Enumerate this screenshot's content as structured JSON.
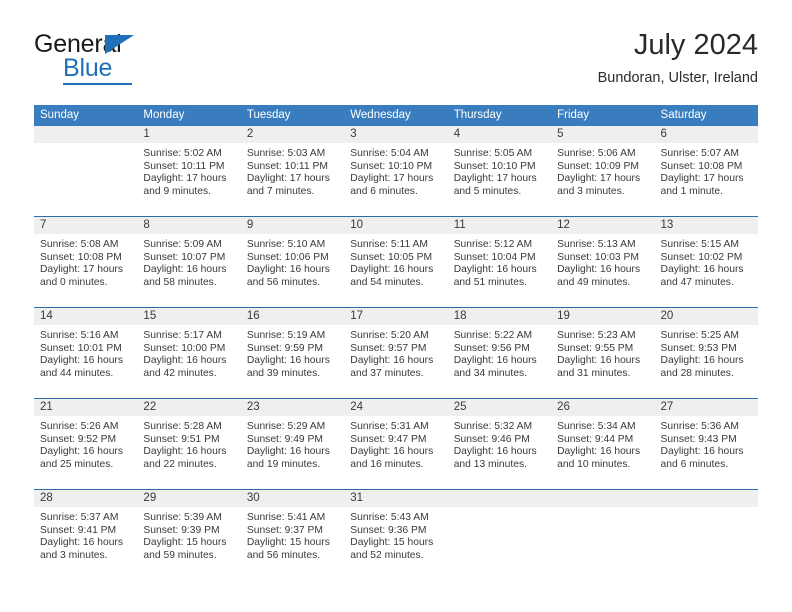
{
  "logo": {
    "word1": "General",
    "word2": "Blue",
    "triangle_icon": "triangle-icon",
    "brand_color": "#1f70b8"
  },
  "header": {
    "title": "July 2024",
    "subtitle": "Bundoran, Ulster, Ireland"
  },
  "calendar": {
    "header_bg": "#3a7dbf",
    "weekday_headers": [
      "Sunday",
      "Monday",
      "Tuesday",
      "Wednesday",
      "Thursday",
      "Friday",
      "Saturday"
    ],
    "weeks": [
      [
        {
          "day": "",
          "lines": []
        },
        {
          "day": "1",
          "lines": [
            "Sunrise: 5:02 AM",
            "Sunset: 10:11 PM",
            "Daylight: 17 hours",
            "and 9 minutes."
          ]
        },
        {
          "day": "2",
          "lines": [
            "Sunrise: 5:03 AM",
            "Sunset: 10:11 PM",
            "Daylight: 17 hours",
            "and 7 minutes."
          ]
        },
        {
          "day": "3",
          "lines": [
            "Sunrise: 5:04 AM",
            "Sunset: 10:10 PM",
            "Daylight: 17 hours",
            "and 6 minutes."
          ]
        },
        {
          "day": "4",
          "lines": [
            "Sunrise: 5:05 AM",
            "Sunset: 10:10 PM",
            "Daylight: 17 hours",
            "and 5 minutes."
          ]
        },
        {
          "day": "5",
          "lines": [
            "Sunrise: 5:06 AM",
            "Sunset: 10:09 PM",
            "Daylight: 17 hours",
            "and 3 minutes."
          ]
        },
        {
          "day": "6",
          "lines": [
            "Sunrise: 5:07 AM",
            "Sunset: 10:08 PM",
            "Daylight: 17 hours",
            "and 1 minute."
          ]
        }
      ],
      [
        {
          "day": "7",
          "lines": [
            "Sunrise: 5:08 AM",
            "Sunset: 10:08 PM",
            "Daylight: 17 hours",
            "and 0 minutes."
          ]
        },
        {
          "day": "8",
          "lines": [
            "Sunrise: 5:09 AM",
            "Sunset: 10:07 PM",
            "Daylight: 16 hours",
            "and 58 minutes."
          ]
        },
        {
          "day": "9",
          "lines": [
            "Sunrise: 5:10 AM",
            "Sunset: 10:06 PM",
            "Daylight: 16 hours",
            "and 56 minutes."
          ]
        },
        {
          "day": "10",
          "lines": [
            "Sunrise: 5:11 AM",
            "Sunset: 10:05 PM",
            "Daylight: 16 hours",
            "and 54 minutes."
          ]
        },
        {
          "day": "11",
          "lines": [
            "Sunrise: 5:12 AM",
            "Sunset: 10:04 PM",
            "Daylight: 16 hours",
            "and 51 minutes."
          ]
        },
        {
          "day": "12",
          "lines": [
            "Sunrise: 5:13 AM",
            "Sunset: 10:03 PM",
            "Daylight: 16 hours",
            "and 49 minutes."
          ]
        },
        {
          "day": "13",
          "lines": [
            "Sunrise: 5:15 AM",
            "Sunset: 10:02 PM",
            "Daylight: 16 hours",
            "and 47 minutes."
          ]
        }
      ],
      [
        {
          "day": "14",
          "lines": [
            "Sunrise: 5:16 AM",
            "Sunset: 10:01 PM",
            "Daylight: 16 hours",
            "and 44 minutes."
          ]
        },
        {
          "day": "15",
          "lines": [
            "Sunrise: 5:17 AM",
            "Sunset: 10:00 PM",
            "Daylight: 16 hours",
            "and 42 minutes."
          ]
        },
        {
          "day": "16",
          "lines": [
            "Sunrise: 5:19 AM",
            "Sunset: 9:59 PM",
            "Daylight: 16 hours",
            "and 39 minutes."
          ]
        },
        {
          "day": "17",
          "lines": [
            "Sunrise: 5:20 AM",
            "Sunset: 9:57 PM",
            "Daylight: 16 hours",
            "and 37 minutes."
          ]
        },
        {
          "day": "18",
          "lines": [
            "Sunrise: 5:22 AM",
            "Sunset: 9:56 PM",
            "Daylight: 16 hours",
            "and 34 minutes."
          ]
        },
        {
          "day": "19",
          "lines": [
            "Sunrise: 5:23 AM",
            "Sunset: 9:55 PM",
            "Daylight: 16 hours",
            "and 31 minutes."
          ]
        },
        {
          "day": "20",
          "lines": [
            "Sunrise: 5:25 AM",
            "Sunset: 9:53 PM",
            "Daylight: 16 hours",
            "and 28 minutes."
          ]
        }
      ],
      [
        {
          "day": "21",
          "lines": [
            "Sunrise: 5:26 AM",
            "Sunset: 9:52 PM",
            "Daylight: 16 hours",
            "and 25 minutes."
          ]
        },
        {
          "day": "22",
          "lines": [
            "Sunrise: 5:28 AM",
            "Sunset: 9:51 PM",
            "Daylight: 16 hours",
            "and 22 minutes."
          ]
        },
        {
          "day": "23",
          "lines": [
            "Sunrise: 5:29 AM",
            "Sunset: 9:49 PM",
            "Daylight: 16 hours",
            "and 19 minutes."
          ]
        },
        {
          "day": "24",
          "lines": [
            "Sunrise: 5:31 AM",
            "Sunset: 9:47 PM",
            "Daylight: 16 hours",
            "and 16 minutes."
          ]
        },
        {
          "day": "25",
          "lines": [
            "Sunrise: 5:32 AM",
            "Sunset: 9:46 PM",
            "Daylight: 16 hours",
            "and 13 minutes."
          ]
        },
        {
          "day": "26",
          "lines": [
            "Sunrise: 5:34 AM",
            "Sunset: 9:44 PM",
            "Daylight: 16 hours",
            "and 10 minutes."
          ]
        },
        {
          "day": "27",
          "lines": [
            "Sunrise: 5:36 AM",
            "Sunset: 9:43 PM",
            "Daylight: 16 hours",
            "and 6 minutes."
          ]
        }
      ],
      [
        {
          "day": "28",
          "lines": [
            "Sunrise: 5:37 AM",
            "Sunset: 9:41 PM",
            "Daylight: 16 hours",
            "and 3 minutes."
          ]
        },
        {
          "day": "29",
          "lines": [
            "Sunrise: 5:39 AM",
            "Sunset: 9:39 PM",
            "Daylight: 15 hours",
            "and 59 minutes."
          ]
        },
        {
          "day": "30",
          "lines": [
            "Sunrise: 5:41 AM",
            "Sunset: 9:37 PM",
            "Daylight: 15 hours",
            "and 56 minutes."
          ]
        },
        {
          "day": "31",
          "lines": [
            "Sunrise: 5:43 AM",
            "Sunset: 9:36 PM",
            "Daylight: 15 hours",
            "and 52 minutes."
          ]
        },
        {
          "day": "",
          "lines": []
        },
        {
          "day": "",
          "lines": []
        },
        {
          "day": "",
          "lines": []
        }
      ]
    ]
  }
}
